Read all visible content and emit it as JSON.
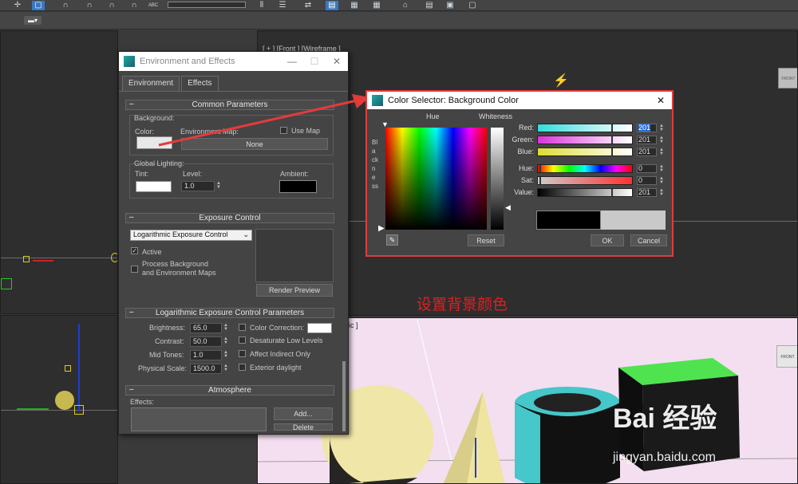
{
  "toolbar": {
    "icons": [
      "move-icon",
      "select-icon",
      "snap-icon",
      "magnet-icon",
      "magnet-icon",
      "text-abc-icon",
      "align-icon",
      "layer-icon",
      "render-icon",
      "render-setup-icon",
      "render-frame-icon",
      "teapot-icon",
      "material-icon",
      "render-icon"
    ],
    "text_abc": "ABC"
  },
  "viewports": {
    "front_label": "[ + ] [Front ] [Wireframe ]",
    "persp_label_tail": "ic ]",
    "front_cube_text": "FRONT",
    "front_cube_text2": "FRONT"
  },
  "env_dialog": {
    "title": "Environment and Effects",
    "tabs": [
      "Environment",
      "Effects"
    ],
    "common": {
      "header": "Common Parameters",
      "background_label": "Background:",
      "color_label": "Color:",
      "env_map_label": "Environment Map:",
      "use_map_label": "Use Map",
      "none_label": "None",
      "global_lighting_label": "Global Lighting:",
      "tint_label": "Tint:",
      "level_label": "Level:",
      "level_value": "1.0",
      "ambient_label": "Ambient:"
    },
    "exposure": {
      "header": "Exposure Control",
      "select_value": "Logarithmic Exposure Control",
      "active_label": "Active",
      "process_label_1": "Process Background",
      "process_label_2": "and Environment Maps",
      "render_preview": "Render Preview"
    },
    "log_params": {
      "header": "Logarithmic Exposure Control Parameters",
      "brightness_label": "Brightness:",
      "brightness": "65.0",
      "contrast_label": "Contrast:",
      "contrast": "50.0",
      "midtones_label": "Mid Tones:",
      "midtones": "1.0",
      "physical_label": "Physical Scale:",
      "physical": "1500.0",
      "color_correction": "Color Correction:",
      "desaturate": "Desaturate Low Levels",
      "affect_indirect": "Affect Indirect Only",
      "exterior_daylight": "Exterior daylight"
    },
    "atmosphere": {
      "header": "Atmosphere",
      "effects_label": "Effects:",
      "add_label": "Add...",
      "delete_label": "Delete"
    }
  },
  "color_selector": {
    "title": "Color Selector: Background Color",
    "hue_label": "Hue",
    "whiteness_label": "Whiteness",
    "blackness_label": "Blackness",
    "channels": [
      {
        "label": "Red:",
        "value": "201",
        "from": "#33dddd",
        "to": "#ffffff"
      },
      {
        "label": "Green:",
        "value": "201",
        "from": "#dd33dd",
        "to": "#ffffff"
      },
      {
        "label": "Blue:",
        "value": "201",
        "from": "#dddd33",
        "to": "#ffffff"
      },
      {
        "label": "Hue:",
        "value": "0",
        "from": "#ff0000",
        "to": "#ff0000"
      },
      {
        "label": "Sat:",
        "value": "0",
        "from": "#cccccc",
        "to": "#ff3030"
      },
      {
        "label": "Value:",
        "value": "201",
        "from": "#000000",
        "to": "#ffffff"
      }
    ],
    "reset_label": "Reset",
    "ok_label": "OK",
    "cancel_label": "Cancel",
    "old_color": "#000000",
    "new_color": "#c9c9c9"
  },
  "annotation": {
    "text": "设置背景颜色"
  },
  "watermark": {
    "brand": "Bai 经验",
    "url": "jingyan.baidu.com"
  },
  "colors": {
    "accent": "#3a78c3",
    "highlight_red": "#e23b3b",
    "bg_color_swatch": "#e8e8e8"
  }
}
